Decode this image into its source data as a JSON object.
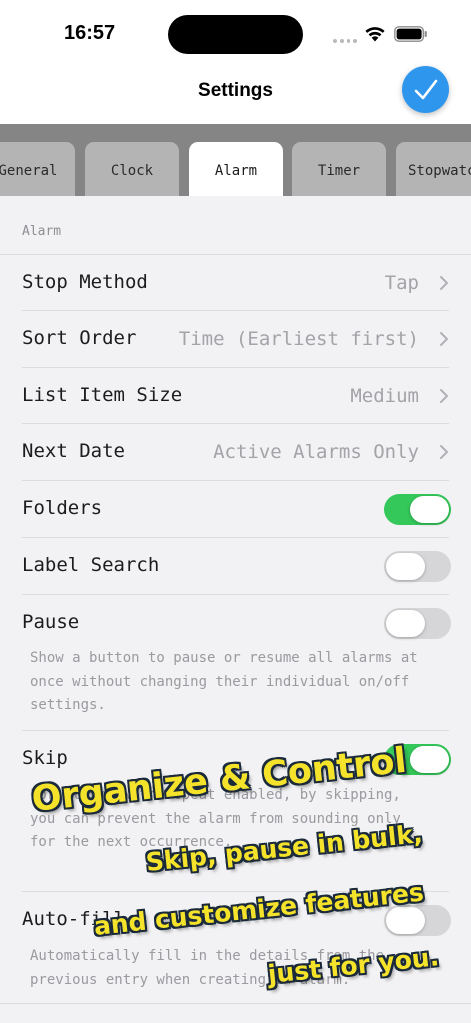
{
  "status_bar": {
    "time": "16:57"
  },
  "nav": {
    "title": "Settings"
  },
  "tabs": [
    {
      "label": "General",
      "active": false
    },
    {
      "label": "Clock",
      "active": false
    },
    {
      "label": "Alarm",
      "active": true
    },
    {
      "label": "Timer",
      "active": false
    },
    {
      "label": "Stopwatch",
      "active": false
    }
  ],
  "section": {
    "header": "Alarm"
  },
  "rows": {
    "stop_method": {
      "label": "Stop Method",
      "value": "Tap"
    },
    "sort_order": {
      "label": "Sort Order",
      "value": "Time (Earliest first)"
    },
    "list_item_size": {
      "label": "List Item Size",
      "value": "Medium"
    },
    "next_date": {
      "label": "Next Date",
      "value": "Active Alarms Only"
    },
    "folders": {
      "label": "Folders",
      "on": true
    },
    "label_search": {
      "label": "Label Search",
      "on": false
    },
    "pause": {
      "label": "Pause",
      "on": false,
      "description": "Show a button to pause or resume all alarms at once without changing their individual on/off settings."
    },
    "skip": {
      "label": "Skip",
      "on": true,
      "description": "For alarms with repeat enabled, by skipping, you can prevent the alarm from sounding only for the next occurrence."
    },
    "auto_fill": {
      "label": "Auto-fill",
      "on": false,
      "description": "Automatically fill in the details from the previous entry when creating an alarm."
    }
  },
  "promo": {
    "title": "Organize & Control",
    "line1": "Skip, pause in bulk,",
    "line2": "and customize features",
    "line3": "just for you."
  },
  "colors": {
    "accent": "#2f96ee",
    "toggle_on": "#34c759",
    "promo_text": "#f4e32a"
  }
}
